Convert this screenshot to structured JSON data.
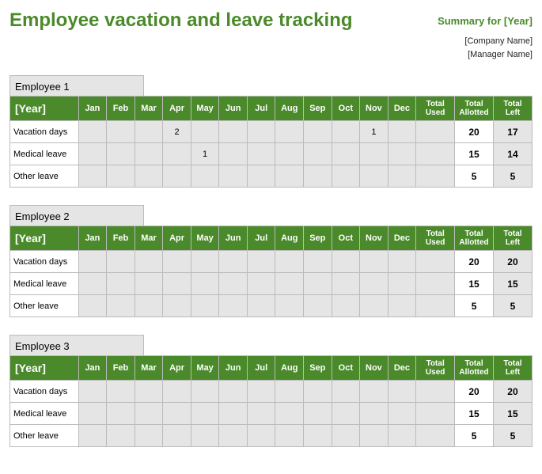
{
  "header": {
    "title": "Employee vacation and leave tracking",
    "summary": "Summary for [Year]",
    "company": "[Company Name]",
    "manager": "[Manager Name]"
  },
  "columns": {
    "year": "[Year]",
    "months": [
      "Jan",
      "Feb",
      "Mar",
      "Apr",
      "May",
      "Jun",
      "Jul",
      "Aug",
      "Sep",
      "Oct",
      "Nov",
      "Dec"
    ],
    "total_used": "Total Used",
    "total_allotted": "Total Allotted",
    "total_left": "Total Left"
  },
  "employees": [
    {
      "name": "Employee 1",
      "rows": [
        {
          "label": "Vacation days",
          "months": [
            "",
            "",
            "",
            "2",
            "",
            "",
            "",
            "",
            "",
            "",
            "1",
            ""
          ],
          "used": "",
          "allotted": "20",
          "left": "17"
        },
        {
          "label": "Medical leave",
          "months": [
            "",
            "",
            "",
            "",
            "1",
            "",
            "",
            "",
            "",
            "",
            "",
            ""
          ],
          "used": "",
          "allotted": "15",
          "left": "14"
        },
        {
          "label": "Other leave",
          "months": [
            "",
            "",
            "",
            "",
            "",
            "",
            "",
            "",
            "",
            "",
            "",
            ""
          ],
          "used": "",
          "allotted": "5",
          "left": "5"
        }
      ]
    },
    {
      "name": "Employee 2",
      "rows": [
        {
          "label": "Vacation days",
          "months": [
            "",
            "",
            "",
            "",
            "",
            "",
            "",
            "",
            "",
            "",
            "",
            ""
          ],
          "used": "",
          "allotted": "20",
          "left": "20"
        },
        {
          "label": "Medical leave",
          "months": [
            "",
            "",
            "",
            "",
            "",
            "",
            "",
            "",
            "",
            "",
            "",
            ""
          ],
          "used": "",
          "allotted": "15",
          "left": "15"
        },
        {
          "label": "Other leave",
          "months": [
            "",
            "",
            "",
            "",
            "",
            "",
            "",
            "",
            "",
            "",
            "",
            ""
          ],
          "used": "",
          "allotted": "5",
          "left": "5"
        }
      ]
    },
    {
      "name": "Employee 3",
      "rows": [
        {
          "label": "Vacation days",
          "months": [
            "",
            "",
            "",
            "",
            "",
            "",
            "",
            "",
            "",
            "",
            "",
            ""
          ],
          "used": "",
          "allotted": "20",
          "left": "20"
        },
        {
          "label": "Medical leave",
          "months": [
            "",
            "",
            "",
            "",
            "",
            "",
            "",
            "",
            "",
            "",
            "",
            ""
          ],
          "used": "",
          "allotted": "15",
          "left": "15"
        },
        {
          "label": "Other leave",
          "months": [
            "",
            "",
            "",
            "",
            "",
            "",
            "",
            "",
            "",
            "",
            "",
            ""
          ],
          "used": "",
          "allotted": "5",
          "left": "5"
        }
      ]
    }
  ]
}
